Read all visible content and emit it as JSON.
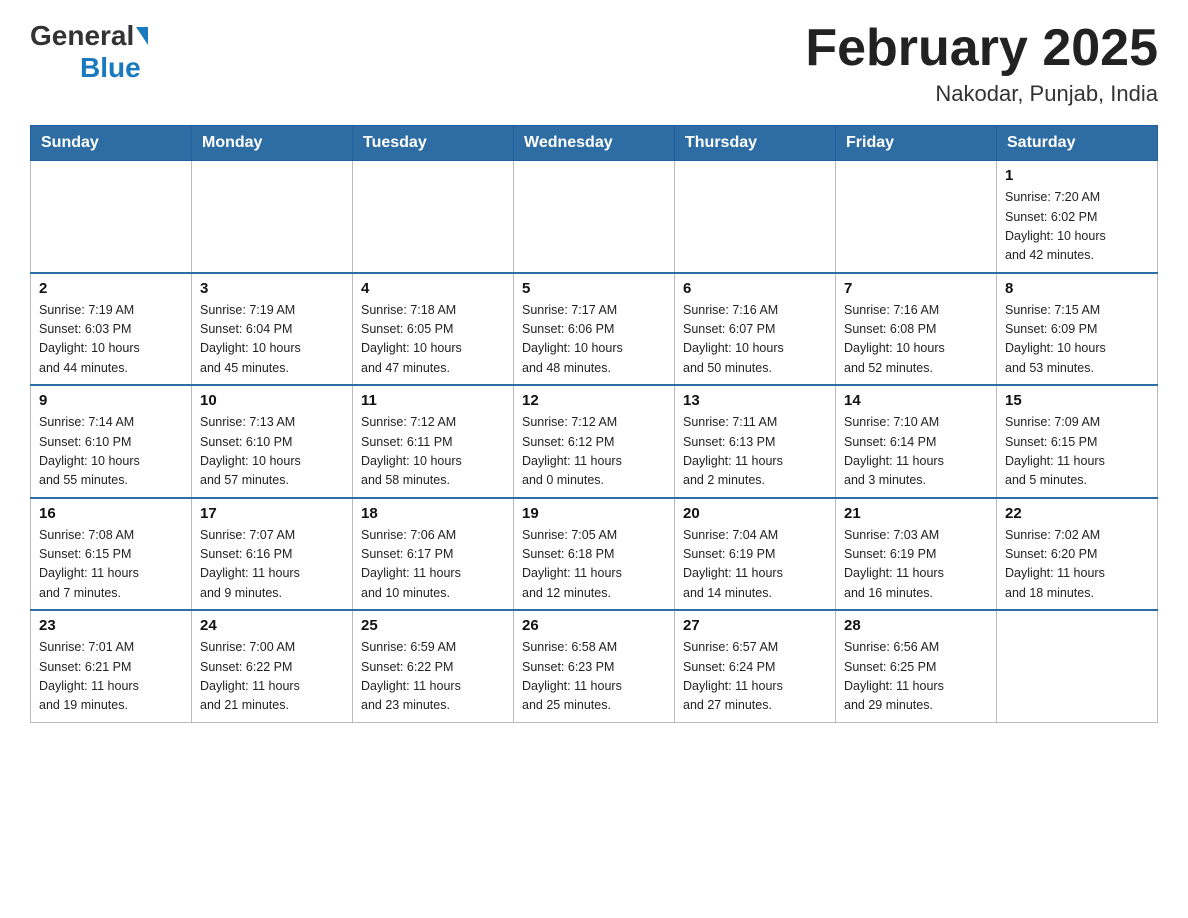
{
  "header": {
    "logo_general": "General",
    "logo_blue": "Blue",
    "month_title": "February 2025",
    "location": "Nakodar, Punjab, India"
  },
  "weekdays": [
    "Sunday",
    "Monday",
    "Tuesday",
    "Wednesday",
    "Thursday",
    "Friday",
    "Saturday"
  ],
  "weeks": [
    [
      {
        "day": "",
        "info": ""
      },
      {
        "day": "",
        "info": ""
      },
      {
        "day": "",
        "info": ""
      },
      {
        "day": "",
        "info": ""
      },
      {
        "day": "",
        "info": ""
      },
      {
        "day": "",
        "info": ""
      },
      {
        "day": "1",
        "info": "Sunrise: 7:20 AM\nSunset: 6:02 PM\nDaylight: 10 hours\nand 42 minutes."
      }
    ],
    [
      {
        "day": "2",
        "info": "Sunrise: 7:19 AM\nSunset: 6:03 PM\nDaylight: 10 hours\nand 44 minutes."
      },
      {
        "day": "3",
        "info": "Sunrise: 7:19 AM\nSunset: 6:04 PM\nDaylight: 10 hours\nand 45 minutes."
      },
      {
        "day": "4",
        "info": "Sunrise: 7:18 AM\nSunset: 6:05 PM\nDaylight: 10 hours\nand 47 minutes."
      },
      {
        "day": "5",
        "info": "Sunrise: 7:17 AM\nSunset: 6:06 PM\nDaylight: 10 hours\nand 48 minutes."
      },
      {
        "day": "6",
        "info": "Sunrise: 7:16 AM\nSunset: 6:07 PM\nDaylight: 10 hours\nand 50 minutes."
      },
      {
        "day": "7",
        "info": "Sunrise: 7:16 AM\nSunset: 6:08 PM\nDaylight: 10 hours\nand 52 minutes."
      },
      {
        "day": "8",
        "info": "Sunrise: 7:15 AM\nSunset: 6:09 PM\nDaylight: 10 hours\nand 53 minutes."
      }
    ],
    [
      {
        "day": "9",
        "info": "Sunrise: 7:14 AM\nSunset: 6:10 PM\nDaylight: 10 hours\nand 55 minutes."
      },
      {
        "day": "10",
        "info": "Sunrise: 7:13 AM\nSunset: 6:10 PM\nDaylight: 10 hours\nand 57 minutes."
      },
      {
        "day": "11",
        "info": "Sunrise: 7:12 AM\nSunset: 6:11 PM\nDaylight: 10 hours\nand 58 minutes."
      },
      {
        "day": "12",
        "info": "Sunrise: 7:12 AM\nSunset: 6:12 PM\nDaylight: 11 hours\nand 0 minutes."
      },
      {
        "day": "13",
        "info": "Sunrise: 7:11 AM\nSunset: 6:13 PM\nDaylight: 11 hours\nand 2 minutes."
      },
      {
        "day": "14",
        "info": "Sunrise: 7:10 AM\nSunset: 6:14 PM\nDaylight: 11 hours\nand 3 minutes."
      },
      {
        "day": "15",
        "info": "Sunrise: 7:09 AM\nSunset: 6:15 PM\nDaylight: 11 hours\nand 5 minutes."
      }
    ],
    [
      {
        "day": "16",
        "info": "Sunrise: 7:08 AM\nSunset: 6:15 PM\nDaylight: 11 hours\nand 7 minutes."
      },
      {
        "day": "17",
        "info": "Sunrise: 7:07 AM\nSunset: 6:16 PM\nDaylight: 11 hours\nand 9 minutes."
      },
      {
        "day": "18",
        "info": "Sunrise: 7:06 AM\nSunset: 6:17 PM\nDaylight: 11 hours\nand 10 minutes."
      },
      {
        "day": "19",
        "info": "Sunrise: 7:05 AM\nSunset: 6:18 PM\nDaylight: 11 hours\nand 12 minutes."
      },
      {
        "day": "20",
        "info": "Sunrise: 7:04 AM\nSunset: 6:19 PM\nDaylight: 11 hours\nand 14 minutes."
      },
      {
        "day": "21",
        "info": "Sunrise: 7:03 AM\nSunset: 6:19 PM\nDaylight: 11 hours\nand 16 minutes."
      },
      {
        "day": "22",
        "info": "Sunrise: 7:02 AM\nSunset: 6:20 PM\nDaylight: 11 hours\nand 18 minutes."
      }
    ],
    [
      {
        "day": "23",
        "info": "Sunrise: 7:01 AM\nSunset: 6:21 PM\nDaylight: 11 hours\nand 19 minutes."
      },
      {
        "day": "24",
        "info": "Sunrise: 7:00 AM\nSunset: 6:22 PM\nDaylight: 11 hours\nand 21 minutes."
      },
      {
        "day": "25",
        "info": "Sunrise: 6:59 AM\nSunset: 6:22 PM\nDaylight: 11 hours\nand 23 minutes."
      },
      {
        "day": "26",
        "info": "Sunrise: 6:58 AM\nSunset: 6:23 PM\nDaylight: 11 hours\nand 25 minutes."
      },
      {
        "day": "27",
        "info": "Sunrise: 6:57 AM\nSunset: 6:24 PM\nDaylight: 11 hours\nand 27 minutes."
      },
      {
        "day": "28",
        "info": "Sunrise: 6:56 AM\nSunset: 6:25 PM\nDaylight: 11 hours\nand 29 minutes."
      },
      {
        "day": "",
        "info": ""
      }
    ]
  ]
}
